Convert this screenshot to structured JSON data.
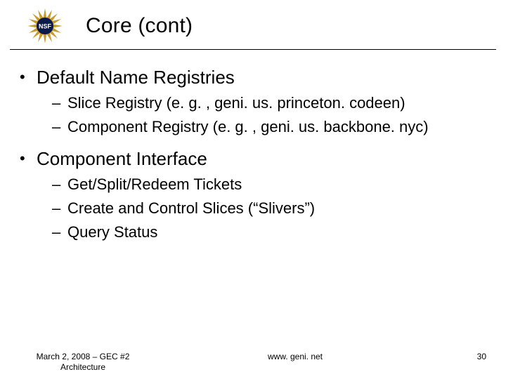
{
  "header": {
    "title": "Core (cont)"
  },
  "bullets": [
    {
      "text": "Default Name Registries",
      "children": [
        "Slice Registry (e. g. , geni. us. princeton. codeen)",
        "Component Registry (e. g. , geni. us. backbone. nyc)"
      ]
    },
    {
      "text": "Component Interface",
      "children": [
        "Get/Split/Redeem Tickets",
        "Create and Control Slices (“Slivers”)",
        "Query Status"
      ]
    }
  ],
  "footer": {
    "left_line1": "March 2, 2008 – GEC #2",
    "left_line2": "Architecture",
    "center": "www. geni. net",
    "right": "30"
  }
}
